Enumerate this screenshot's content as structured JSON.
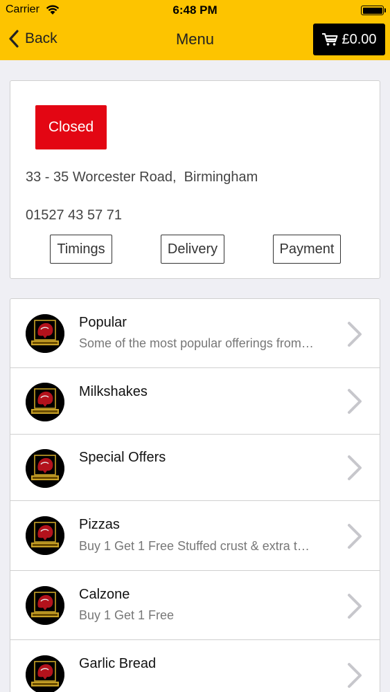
{
  "status_bar": {
    "carrier": "Carrier",
    "time": "6:48 PM"
  },
  "nav": {
    "back_label": "Back",
    "title": "Menu",
    "cart_total": "£0.00"
  },
  "restaurant": {
    "status": "Closed",
    "address": "33 - 35 Worcester Road,  Birmingham",
    "phone": "01527 43 57 71",
    "buttons": {
      "timings": "Timings",
      "delivery": "Delivery",
      "payment": "Payment"
    }
  },
  "categories": [
    {
      "title": "Popular",
      "subtitle": "Some of the most popular offerings from…"
    },
    {
      "title": "Milkshakes",
      "subtitle": ""
    },
    {
      "title": "Special Offers",
      "subtitle": ""
    },
    {
      "title": "Pizzas",
      "subtitle": "Buy 1 Get 1 Free Stuffed crust & extra t…"
    },
    {
      "title": "Calzone",
      "subtitle": "Buy 1 Get 1 Free"
    },
    {
      "title": "Garlic Bread",
      "subtitle": ""
    }
  ],
  "colors": {
    "accent": "#fdc400",
    "closed": "#e30613",
    "cart_bg": "#000000"
  },
  "icons": {
    "back": "chevron-left-icon",
    "cart": "cart-icon",
    "row": "chevron-right-icon",
    "logo": "restaurant-logo"
  }
}
